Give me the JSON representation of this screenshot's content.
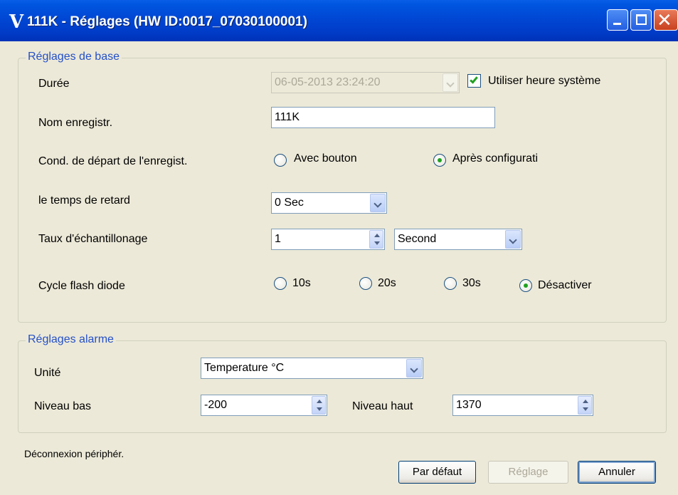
{
  "window": {
    "title": "111K - Réglages (HW ID:0017_07030100001)",
    "logo": "V"
  },
  "basic_settings": {
    "group_title": "Réglages de base",
    "duration": {
      "label": "Durée",
      "value": "06-05-2013 23:24:20",
      "use_system_time_label": "Utiliser heure système",
      "use_system_time_checked": true
    },
    "record_name": {
      "label": "Nom enregistr.",
      "value": "111K"
    },
    "start_condition": {
      "label": "Cond. de départ de l'enregist.",
      "options": [
        "Avec bouton",
        "Après configurati"
      ],
      "selected": 1
    },
    "delay": {
      "label": "le temps de retard",
      "value": "0 Sec"
    },
    "sample_rate": {
      "label": "Taux d'échantillonage",
      "value": "1",
      "unit": "Second"
    },
    "led_flash": {
      "label": "Cycle flash diode",
      "options": [
        "10s",
        "20s",
        "30s",
        "Désactiver"
      ],
      "selected": 3
    }
  },
  "alarm_settings": {
    "group_title": "Réglages alarme",
    "unit": {
      "label": "Unité",
      "value": "Temperature °C"
    },
    "low_level": {
      "label": "Niveau bas",
      "value": "-200"
    },
    "high_level": {
      "label": "Niveau haut",
      "value": "1370"
    }
  },
  "status_text": "Déconnexion périphér.",
  "buttons": {
    "default_label": "Par défaut",
    "apply_label": "Réglage",
    "cancel_label": "Annuler"
  },
  "colors": {
    "title_bar": "#0047d4",
    "group_title": "#2450c8",
    "check_mark": "#21a121",
    "dialog_bg": "#ece9d8"
  }
}
